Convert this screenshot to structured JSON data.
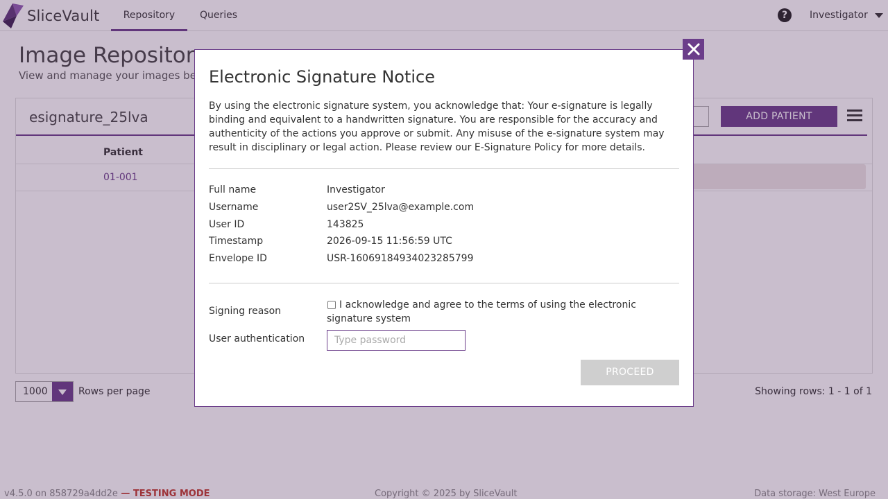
{
  "app": {
    "name": "SliceVault",
    "brand_color": "#6b3d8a"
  },
  "nav": {
    "tabs": [
      {
        "label": "Repository",
        "active": true
      },
      {
        "label": "Queries",
        "active": false
      }
    ],
    "user": "Investigator"
  },
  "page": {
    "title": "Image Repository",
    "subtitle": "View and manage your images bel"
  },
  "panel": {
    "title": "esignature_25lva",
    "add_patient_label": "ADD PATIENT",
    "column_header": "Patient",
    "rows": [
      {
        "patient": "01-001"
      }
    ]
  },
  "pagination": {
    "rows_per_page_value": "1000",
    "rows_per_page_label": "Rows per page",
    "showing": "Showing rows: 1 - 1 of 1"
  },
  "footer": {
    "version": "v4.5.0 on 858729a4dd2e",
    "separator": " — ",
    "mode": "TESTING MODE",
    "copyright": "Copyright © 2025 by SliceVault",
    "storage": "Data storage: West Europe"
  },
  "modal": {
    "title": "Electronic Signature Notice",
    "notice": "By using the electronic signature system, you acknowledge that: Your e-signature is legally binding and equivalent to a handwritten signature. You are responsible for the accuracy and authenticity of the actions you approve or submit. Any misuse of the e-signature system may result in disciplinary or legal action. Please review our E-Signature Policy for more details.",
    "fields": {
      "full_name_label": "Full name",
      "full_name": "Investigator",
      "username_label": "Username",
      "username": "user2SV_25lva@example.com",
      "user_id_label": "User ID",
      "user_id": "143825",
      "timestamp_label": "Timestamp",
      "timestamp": "2026-09-15 11:56:59 UTC",
      "envelope_label": "Envelope ID",
      "envelope": "USR-16069184934023285799"
    },
    "signing_reason_label": "Signing reason",
    "ack_text": "I acknowledge and agree to the terms of using the electronic signature system",
    "ack_checked": false,
    "auth_label": "User authentication",
    "password_placeholder": "Type password",
    "proceed_label": "PROCEED"
  }
}
